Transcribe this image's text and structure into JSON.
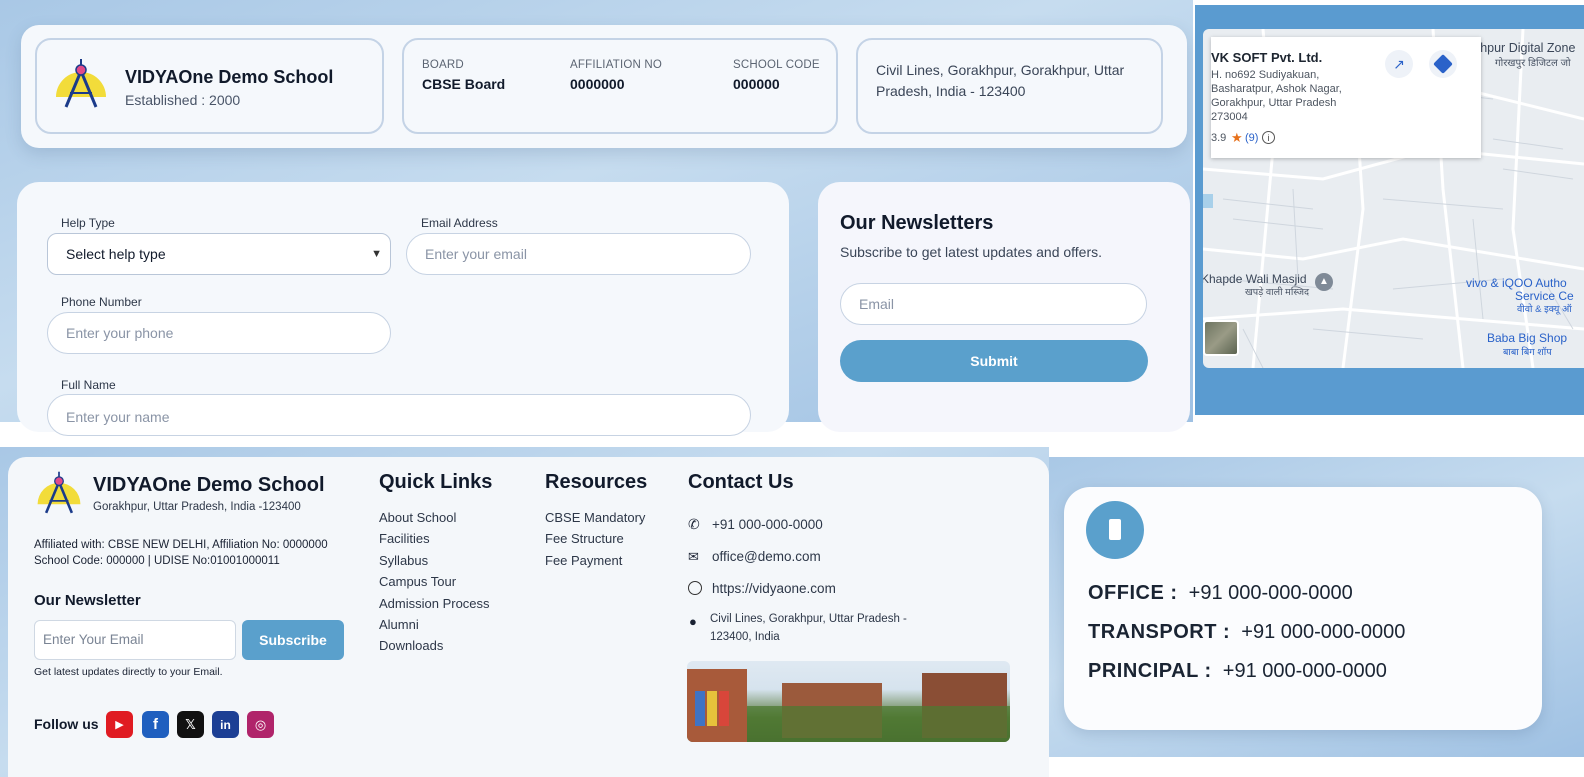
{
  "header": {
    "school_name": "VIDYAOne Demo School",
    "established": "Established : 2000",
    "board_label": "BOARD",
    "board_value": "CBSE Board",
    "affiliation_label": "AFFILIATION NO",
    "affiliation_value": "0000000",
    "school_code_label": "SCHOOL CODE",
    "school_code_value": "000000",
    "address": "Civil Lines, Gorakhpur, Gorakhpur, Uttar Pradesh, India - 123400"
  },
  "help_form": {
    "help_type_label": "Help Type",
    "help_type_selected": "Select help type",
    "email_label": "Email Address",
    "email_placeholder": "Enter your email",
    "phone_label": "Phone Number",
    "phone_placeholder": "Enter your phone",
    "name_label": "Full Name",
    "name_placeholder": "Enter your name"
  },
  "newsletter_panel": {
    "title": "Our Newsletters",
    "subtitle": "Subscribe to get latest updates and offers.",
    "email_placeholder": "Email",
    "submit_label": "Submit"
  },
  "map": {
    "place_name": "VK SOFT Pvt. Ltd.",
    "address_line1": "H. no692 Sudiyakuan,",
    "address_line2": "Basharatpur, Ashok Nagar,",
    "address_line3": "Gorakhpur, Uttar Pradesh",
    "address_line4": "273004",
    "rating": "3.9",
    "reviews": "(9)",
    "label_digital": "akhpur Digital Zone",
    "label_digital_hi": "गोरखपुर डिजिटल जो",
    "label_masjid": "Khapde Wali Masjid",
    "label_masjid_hi": "खपड़े वाली मस्जिद",
    "label_vivo": "vivo & iQOO Autho",
    "label_vivo2": "Service Ce",
    "label_vivo_hi": "वीवो & इक्यू ऑ",
    "label_baba": "Baba Big Shop",
    "label_baba_hi": "बाबा बिग शॉप"
  },
  "footer": {
    "school_name": "VIDYAOne Demo School",
    "location": "Gorakhpur, Uttar Pradesh, India -123400",
    "affiliation_line": "Affiliated with: CBSE NEW DELHI, Affiliation No: 0000000",
    "code_line": "School Code: 000000 | UDISE No:01001000011",
    "newsletter_title": "Our Newsletter",
    "newsletter_placeholder": "Enter Your Email",
    "subscribe_label": "Subscribe",
    "newsletter_note": "Get latest updates directly to your Email.",
    "follow_label": "Follow us",
    "social": {
      "youtube": "▶",
      "facebook": "f",
      "x": "𝕏",
      "linkedin": "in",
      "instagram": "◎"
    },
    "quick_links_title": "Quick Links",
    "quick_links": [
      "About School",
      "Facilities",
      "Syllabus",
      "Campus Tour",
      "Admission Process",
      "Alumni",
      "Downloads"
    ],
    "resources_title": "Resources",
    "resources": [
      "CBSE Mandatory",
      "Fee Structure",
      "Fee Payment"
    ],
    "contact_title": "Contact Us",
    "contact_phone": "+91 000-000-0000",
    "contact_email": "office@demo.com",
    "contact_web": "https://vidyaone.com",
    "contact_addr1": "Civil Lines, Gorakhpur, Uttar Pradesh -",
    "contact_addr2": "123400, India"
  },
  "phone_card": {
    "office_label": "OFFICE :",
    "office_value": "+91 000-000-0000",
    "transport_label": "TRANSPORT :",
    "transport_value": "+91 000-000-0000",
    "principal_label": "PRINCIPAL :",
    "principal_value": "+91 000-000-0000"
  },
  "colors": {
    "accent": "#5aa0cc",
    "background_blue": "#a9c8e6",
    "youtube": "#e01b22",
    "facebook": "#1f5fbf",
    "x": "#111111",
    "linkedin": "#1c3f94",
    "instagram": "#b0246a"
  },
  "icons": [
    "logo-compass-icon",
    "chevron-down-icon",
    "open-external-icon",
    "directions-icon",
    "star-icon",
    "info-icon",
    "mosque-pin-icon",
    "phone-icon",
    "mail-icon",
    "globe-icon",
    "map-pin-icon",
    "mobile-icon"
  ]
}
